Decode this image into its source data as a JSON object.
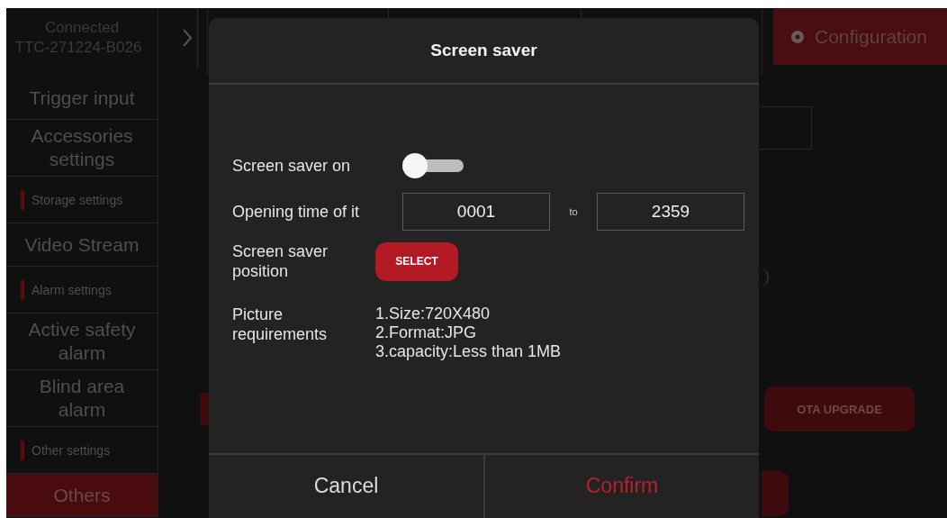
{
  "sidebar": {
    "device_status": "Connected",
    "device_id": "TTC-271224-B026",
    "items": [
      {
        "kind": "item",
        "label": "Trigger input",
        "selected": false
      },
      {
        "kind": "item",
        "label": "Accessories settings",
        "selected": false
      },
      {
        "kind": "section",
        "label": "Storage settings"
      },
      {
        "kind": "item",
        "label": "Video Stream",
        "selected": false
      },
      {
        "kind": "section",
        "label": "Alarm settings"
      },
      {
        "kind": "item",
        "label": "Active safety alarm",
        "selected": false
      },
      {
        "kind": "item",
        "label": "Blind area alarm",
        "selected": false
      },
      {
        "kind": "section",
        "label": "Other settings"
      },
      {
        "kind": "item",
        "label": "Others",
        "selected": true
      }
    ]
  },
  "tabs": [
    {
      "label": "Configuration",
      "selected": true
    }
  ],
  "background_buttons": [
    {
      "label": "OTA UPGRADE"
    }
  ],
  "dialog": {
    "title": "Screen saver",
    "rows": [
      {
        "kind": "toggle",
        "label": "Screen saver on",
        "on": false
      },
      {
        "kind": "time_range",
        "label": "Opening time of it",
        "from": "0001",
        "separator": "to",
        "to": "2359"
      },
      {
        "kind": "select",
        "label": "Screen saver position",
        "button": "SELECT"
      },
      {
        "kind": "info",
        "label": "Picture requirements",
        "lines": [
          "1.Size:720X480",
          "2.Format:JPG",
          "3.capacity:Less than 1MB"
        ]
      }
    ],
    "buttons": [
      {
        "label": "Cancel",
        "kind": "cancel"
      },
      {
        "label": "Confirm",
        "kind": "confirm"
      }
    ]
  }
}
